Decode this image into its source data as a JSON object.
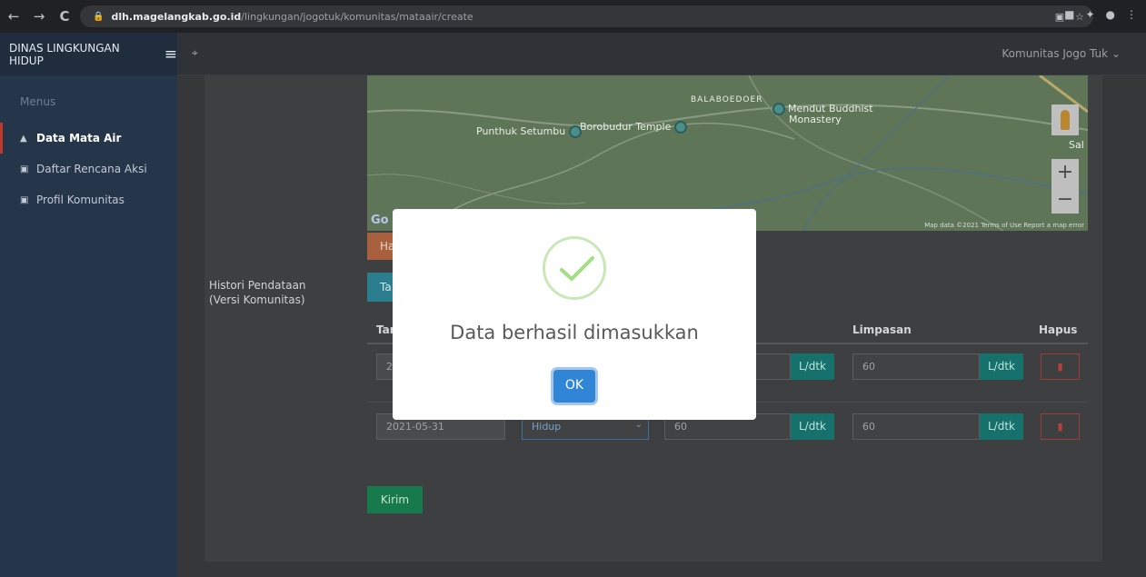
{
  "browser": {
    "url_host": "dlh.magelangkab.go.id",
    "url_path": "/lingkungan/jogotuk/komunitas/mataair/create",
    "back_icon": "back-arrow-icon",
    "forward_icon": "forward-arrow-icon",
    "reload_icon": "reload-icon",
    "nav_back": "←",
    "nav_forward": "→",
    "nav_reload": "C"
  },
  "sidebar": {
    "brand": "DINAS LINGKUNGAN HIDUP",
    "menus_label": "Menus",
    "items": [
      {
        "label": "Data Mata Air",
        "icon": "water-drop-icon"
      },
      {
        "label": "Daftar Rencana Aksi",
        "icon": "group-icon"
      },
      {
        "label": "Profil Komunitas",
        "icon": "group-icon"
      }
    ]
  },
  "topbar": {
    "user": "Komunitas Jogo Tuk",
    "user_caret": "⌄"
  },
  "map": {
    "labels": {
      "balaboedoer": "BALABOEDOER",
      "mendut": "Mendut Buddhist",
      "mendut2": "Monastery",
      "punthuk": "Punthuk Setumbu",
      "borobudur": "Borobudur Temple",
      "sal": "Sal"
    },
    "google": "Go",
    "footer": "Map data ©2021   Terms of Use   Report a map error",
    "zoom_in": "+",
    "zoom_out": "−"
  },
  "form": {
    "histori_label_line1": "Histori Pendataan",
    "histori_label_line2": "(Versi Komunitas)",
    "orange_btn_fragment": "Ha",
    "teal_btn_fragment": "Ta",
    "columns": {
      "tanggal_fragment": "Tan",
      "limpasan": "Limpasan",
      "hapus": "Hapus"
    },
    "rows": [
      {
        "date": "2",
        "status": "",
        "debit": "",
        "unit1": "L/dtk",
        "limpasan": "60",
        "unit2": "L/dtk"
      },
      {
        "date": "2021-05-31",
        "status": "Hidup",
        "debit": "60",
        "unit1": "L/dtk",
        "limpasan": "60",
        "unit2": "L/dtk"
      }
    ],
    "submit": "Kirim"
  },
  "modal": {
    "title": "Data berhasil dimasukkan",
    "ok": "OK"
  }
}
